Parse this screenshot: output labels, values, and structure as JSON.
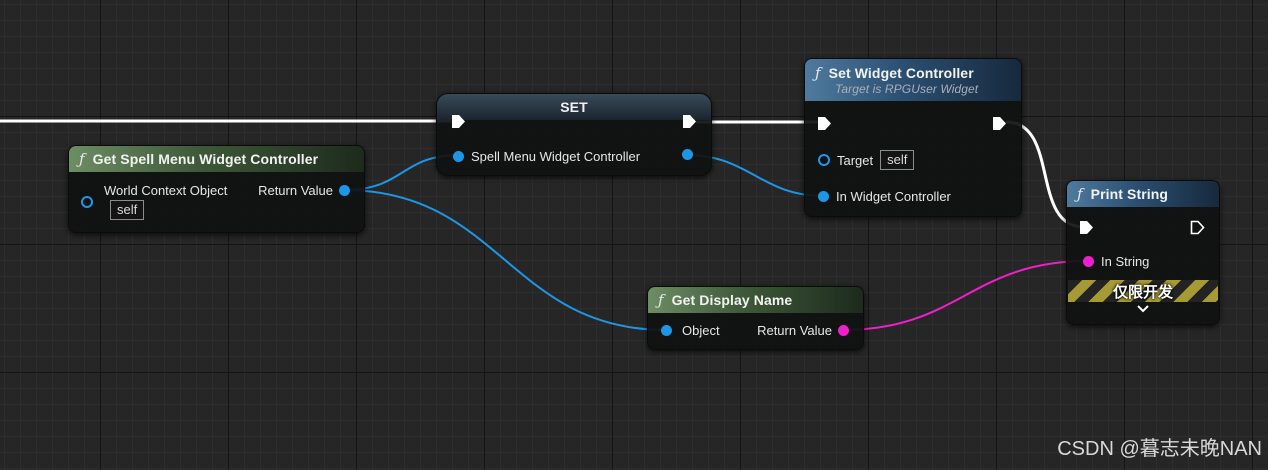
{
  "nodes": {
    "get_controller": {
      "title": "Get Spell Menu Widget Controller",
      "icon": "function-icon",
      "input_label": "World Context Object",
      "input_value": "self",
      "output_label": "Return Value"
    },
    "set": {
      "title": "SET",
      "pin_label": "Spell Menu Widget Controller"
    },
    "set_widget_controller": {
      "title": "Set Widget Controller",
      "subtitle": "Target is RPGUser Widget",
      "icon": "function-icon",
      "target_label": "Target",
      "target_value": "self",
      "in_controller_label": "In Widget Controller"
    },
    "print_string": {
      "title": "Print String",
      "icon": "function-icon",
      "in_string_label": "In String",
      "dev_only_label": "仅限开发",
      "expand_icon": "chevron-down-icon"
    },
    "get_display_name": {
      "title": "Get Display Name",
      "icon": "function-icon",
      "input_label": "Object",
      "output_label": "Return Value"
    }
  },
  "colors": {
    "exec_wire": "#ffffff",
    "object_wire": "#1e96e6",
    "string_wire": "#f01ecb",
    "function_header": "#6d8d64",
    "set_header": "#4f7a9e"
  },
  "watermark": "CSDN @暮志未晚NAN"
}
